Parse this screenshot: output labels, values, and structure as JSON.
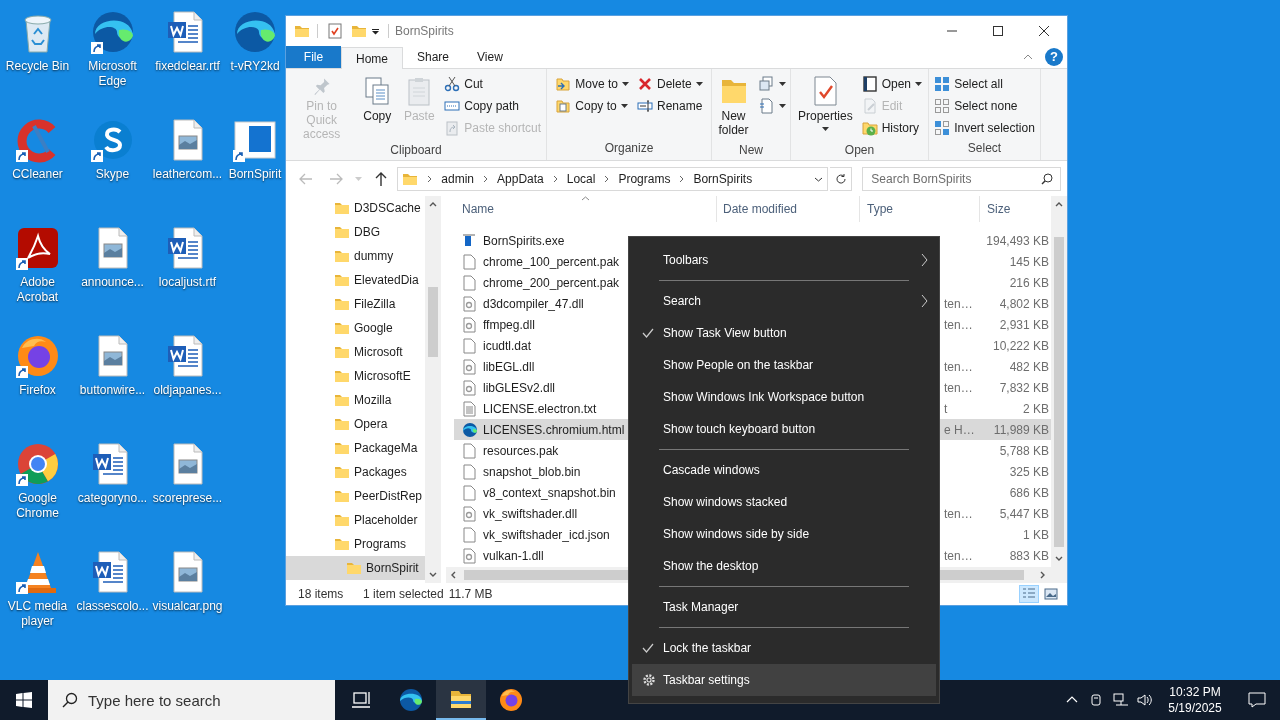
{
  "desktop_icons": [
    {
      "label": "Recycle Bin",
      "shortcut": false
    },
    {
      "label": "CCleaner",
      "shortcut": true
    },
    {
      "label": "Adobe Acrobat",
      "shortcut": true
    },
    {
      "label": "Firefox",
      "shortcut": true
    },
    {
      "label": "Google Chrome",
      "shortcut": true
    },
    {
      "label": "VLC media player",
      "shortcut": true
    },
    {
      "label": "Microsoft Edge",
      "shortcut": true
    },
    {
      "label": "Skype",
      "shortcut": true
    },
    {
      "label": "announce...",
      "shortcut": false
    },
    {
      "label": "buttonwire...",
      "shortcut": false
    },
    {
      "label": "categoryno...",
      "shortcut": false
    },
    {
      "label": "classescolo...",
      "shortcut": false
    },
    {
      "label": "fixedclear.rtf",
      "shortcut": false
    },
    {
      "label": "leathercom...",
      "shortcut": false
    },
    {
      "label": "localjust.rtf",
      "shortcut": false
    },
    {
      "label": "oldjapanes...",
      "shortcut": false
    },
    {
      "label": "scoreprese...",
      "shortcut": false
    },
    {
      "label": "visualcar.png",
      "shortcut": false
    },
    {
      "label": "t-vRY2kd",
      "shortcut": false
    },
    {
      "label": "BornSpirit",
      "shortcut": true
    }
  ],
  "window": {
    "title": "BornSpirits",
    "help": "?",
    "tabs": [
      {
        "label": "File",
        "kind": "file",
        "selected": false
      },
      {
        "label": "Home",
        "kind": "tab",
        "selected": true
      },
      {
        "label": "Share",
        "kind": "tab",
        "selected": false
      },
      {
        "label": "View",
        "kind": "tab",
        "selected": false
      }
    ],
    "ribbon": [
      {
        "label": "Clipboard",
        "columns": [
          {
            "kind": "large",
            "items": [
              {
                "label": "Pin to Quick access",
                "disabled": true,
                "dropdown": false
              }
            ]
          },
          {
            "kind": "large",
            "items": [
              {
                "label": "Copy",
                "disabled": false,
                "dropdown": false
              }
            ]
          },
          {
            "kind": "large",
            "items": [
              {
                "label": "Paste",
                "disabled": true,
                "dropdown": false
              }
            ]
          },
          {
            "kind": "small",
            "items": [
              {
                "label": "Cut",
                "disabled": false,
                "dropdown": false
              },
              {
                "label": "Copy path",
                "disabled": false,
                "dropdown": false
              },
              {
                "label": "Paste shortcut",
                "disabled": true,
                "dropdown": false
              }
            ]
          }
        ]
      },
      {
        "label": "Organize",
        "columns": [
          {
            "kind": "small",
            "items": [
              {
                "label": "Move to",
                "disabled": false,
                "dropdown": true
              },
              {
                "label": "Copy to",
                "disabled": false,
                "dropdown": true
              }
            ]
          },
          {
            "kind": "small",
            "items": [
              {
                "label": "Delete",
                "disabled": false,
                "dropdown": true
              },
              {
                "label": "Rename",
                "disabled": false,
                "dropdown": false
              }
            ]
          }
        ]
      },
      {
        "label": "New",
        "columns": [
          {
            "kind": "large",
            "items": [
              {
                "label": "New folder",
                "disabled": false,
                "dropdown": false
              }
            ]
          },
          {
            "kind": "small",
            "items": [
              {
                "disabled": false,
                "dropdown": true
              },
              {
                "disabled": false,
                "dropdown": true
              }
            ]
          }
        ]
      },
      {
        "label": "Open",
        "columns": [
          {
            "kind": "large",
            "items": [
              {
                "label": "Properties",
                "disabled": false,
                "dropdown": true
              }
            ]
          },
          {
            "kind": "small",
            "items": [
              {
                "label": "Open",
                "disabled": false,
                "dropdown": true
              },
              {
                "label": "Edit",
                "disabled": true,
                "dropdown": false
              },
              {
                "label": "History",
                "disabled": false,
                "dropdown": false
              }
            ]
          }
        ]
      },
      {
        "label": "Select",
        "columns": [
          {
            "kind": "small",
            "items": [
              {
                "label": "Select all",
                "disabled": false,
                "dropdown": false
              },
              {
                "label": "Select none",
                "disabled": false,
                "dropdown": false
              },
              {
                "label": "Invert selection",
                "disabled": false,
                "dropdown": false
              }
            ]
          }
        ]
      }
    ],
    "breadcrumbs": [
      "admin",
      "AppData",
      "Local",
      "Programs",
      "BornSpirits"
    ],
    "search": {
      "placeholder": "Search BornSpirits"
    },
    "folders": [
      {
        "label": "D3DSCache",
        "selected": false
      },
      {
        "label": "DBG",
        "selected": false
      },
      {
        "label": "dummy",
        "selected": false
      },
      {
        "label": "ElevatedDia",
        "selected": false
      },
      {
        "label": "FileZilla",
        "selected": false
      },
      {
        "label": "Google",
        "selected": false
      },
      {
        "label": "Microsoft",
        "selected": false
      },
      {
        "label": "MicrosoftE",
        "selected": false
      },
      {
        "label": "Mozilla",
        "selected": false
      },
      {
        "label": "Opera",
        "selected": false
      },
      {
        "label": "PackageMa",
        "selected": false
      },
      {
        "label": "Packages",
        "selected": false
      },
      {
        "label": "PeerDistRep",
        "selected": false
      },
      {
        "label": "Placeholder",
        "selected": false
      },
      {
        "label": "Programs",
        "selected": false,
        "children": [
          {
            "label": "BornSpirit",
            "selected": true
          }
        ]
      }
    ],
    "columns": [
      "Name",
      "Date modified",
      "Type",
      "Size"
    ],
    "files": [
      {
        "name": "BornSpirits.exe",
        "kind": "exe",
        "size": "194,493 KB",
        "selected": false
      },
      {
        "name": "chrome_100_percent.pak",
        "kind": "file",
        "size": "145 KB",
        "selected": false
      },
      {
        "name": "chrome_200_percent.pak",
        "kind": "file",
        "size": "216 KB",
        "selected": false
      },
      {
        "name": "d3dcompiler_47.dll",
        "kind": "dll",
        "type": "ten…",
        "size": "4,802 KB",
        "selected": false
      },
      {
        "name": "ffmpeg.dll",
        "kind": "dll",
        "type": "ten…",
        "size": "2,931 KB",
        "selected": false
      },
      {
        "name": "icudtl.dat",
        "kind": "file",
        "size": "10,222 KB",
        "selected": false
      },
      {
        "name": "libEGL.dll",
        "kind": "dll",
        "type": "ten…",
        "size": "482 KB",
        "selected": false
      },
      {
        "name": "libGLESv2.dll",
        "kind": "dll",
        "type": "ten…",
        "size": "7,832 KB",
        "selected": false
      },
      {
        "name": "LICENSE.electron.txt",
        "kind": "text",
        "type": "t",
        "size": "2 KB",
        "selected": false
      },
      {
        "name": "LICENSES.chromium.html",
        "kind": "html",
        "type": "e H…",
        "size": "11,989 KB",
        "selected": true
      },
      {
        "name": "resources.pak",
        "kind": "file",
        "size": "5,788 KB",
        "selected": false
      },
      {
        "name": "snapshot_blob.bin",
        "kind": "file",
        "size": "325 KB",
        "selected": false
      },
      {
        "name": "v8_context_snapshot.bin",
        "kind": "file",
        "size": "686 KB",
        "selected": false
      },
      {
        "name": "vk_swiftshader.dll",
        "kind": "dll",
        "type": "ten…",
        "size": "5,447 KB",
        "selected": false
      },
      {
        "name": "vk_swiftshader_icd.json",
        "kind": "file",
        "size": "1 KB",
        "selected": false
      },
      {
        "name": "vulkan-1.dll",
        "kind": "dll",
        "type": "ten…",
        "size": "883 KB",
        "selected": false
      }
    ],
    "status_bar": {
      "items": "18 items",
      "selection": "1 item selected",
      "size": "11.7 MB"
    },
    "views": [
      {
        "selected": true
      },
      {
        "selected": false
      }
    ]
  },
  "context_menu": [
    {
      "kind": "item",
      "label": "Toolbars",
      "submenu": true,
      "checked": false,
      "selected": false
    },
    {
      "kind": "separator"
    },
    {
      "kind": "item",
      "label": "Search",
      "submenu": true,
      "checked": false,
      "selected": false
    },
    {
      "kind": "item",
      "label": "Show Task View button",
      "submenu": false,
      "checked": true,
      "selected": false
    },
    {
      "kind": "item",
      "label": "Show People on the taskbar",
      "submenu": false,
      "checked": false,
      "selected": false
    },
    {
      "kind": "item",
      "label": "Show Windows Ink Workspace button",
      "submenu": false,
      "checked": false,
      "selected": false
    },
    {
      "kind": "item",
      "label": "Show touch keyboard button",
      "submenu": false,
      "checked": false,
      "selected": false
    },
    {
      "kind": "separator"
    },
    {
      "kind": "item",
      "label": "Cascade windows",
      "submenu": false,
      "checked": false,
      "selected": false
    },
    {
      "kind": "item",
      "label": "Show windows stacked",
      "submenu": false,
      "checked": false,
      "selected": false
    },
    {
      "kind": "item",
      "label": "Show windows side by side",
      "submenu": false,
      "checked": false,
      "selected": false
    },
    {
      "kind": "item",
      "label": "Show the desktop",
      "submenu": false,
      "checked": false,
      "selected": false
    },
    {
      "kind": "separator"
    },
    {
      "kind": "item",
      "label": "Task Manager",
      "submenu": false,
      "checked": false,
      "selected": false
    },
    {
      "kind": "separator"
    },
    {
      "kind": "item",
      "label": "Lock the taskbar",
      "submenu": false,
      "checked": true,
      "selected": false
    },
    {
      "kind": "settings",
      "label": "Taskbar settings",
      "submenu": false,
      "checked": false,
      "selected": true
    }
  ],
  "taskbar": {
    "search_placeholder": "Type here to search",
    "apps": [
      {
        "selected": false
      },
      {
        "selected": false
      },
      {
        "selected": true
      },
      {
        "selected": false
      }
    ],
    "time": "10:32 PM",
    "date": "5/19/2025"
  }
}
